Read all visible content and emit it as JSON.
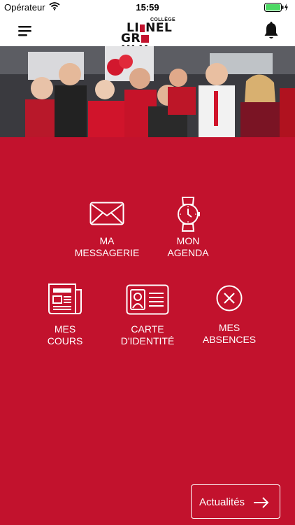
{
  "status_bar": {
    "carrier": "Opérateur",
    "time": "15:59"
  },
  "header": {
    "logo_top": "COLLÈGE",
    "logo_line1": [
      "LI",
      "NEL"
    ],
    "logo_line2": [
      "GR",
      "ULX"
    ],
    "accent": "#c2122d"
  },
  "tiles": {
    "messagerie": {
      "line1": "MA",
      "line2": "MESSAGERIE",
      "icon": "envelope-icon"
    },
    "agenda": {
      "line1": "MON",
      "line2": "AGENDA",
      "icon": "watch-icon"
    },
    "cours": {
      "line1": "MES",
      "line2": "COURS",
      "icon": "newspaper-icon"
    },
    "carte": {
      "line1": "CARTE",
      "line2": "D'IDENTITÉ",
      "icon": "id-card-icon"
    },
    "absences": {
      "line1": "MES",
      "line2": "ABSENCES",
      "icon": "circle-x-icon"
    }
  },
  "news_button": {
    "label": "Actualités",
    "icon": "arrow-right-icon"
  },
  "colors": {
    "background": "#c2122d",
    "header_bg": "#ffffff",
    "foreground": "#ffffff"
  }
}
